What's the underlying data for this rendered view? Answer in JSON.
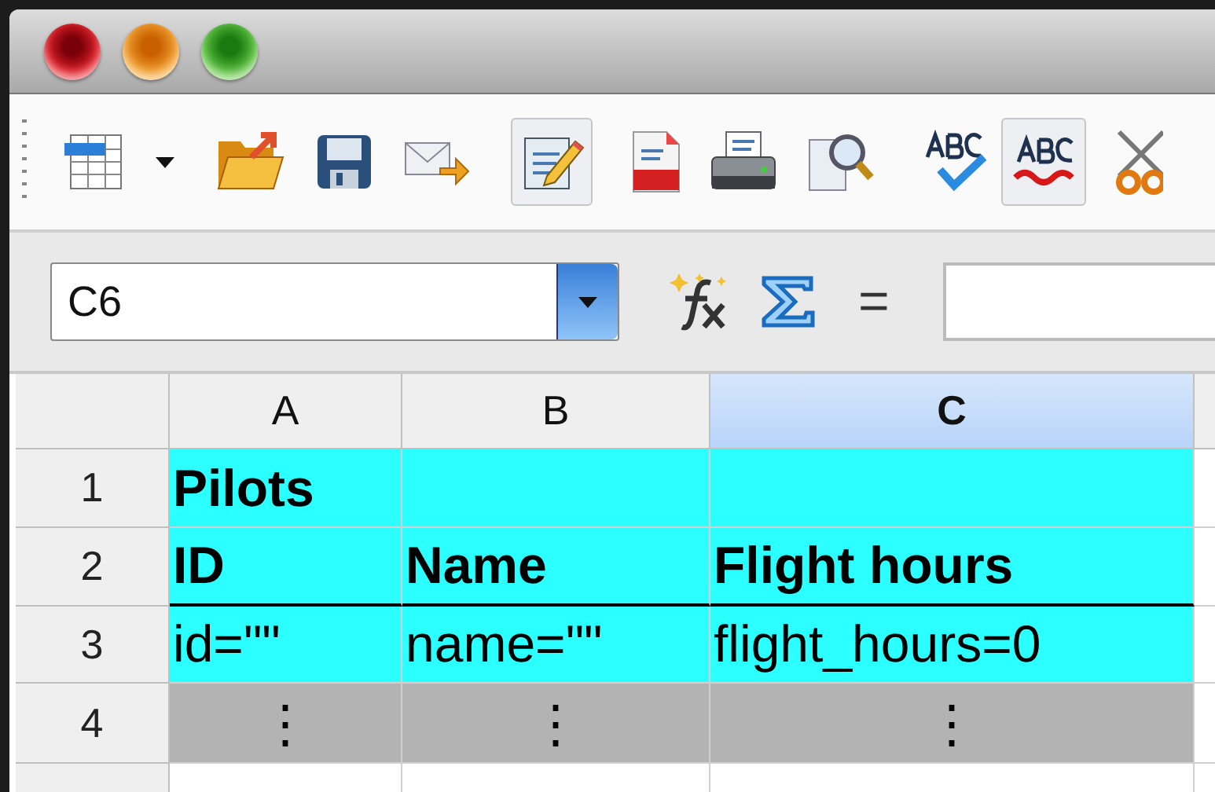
{
  "window": {
    "buttons": [
      {
        "kind": "close"
      },
      {
        "kind": "minimize"
      },
      {
        "kind": "zoom"
      }
    ]
  },
  "toolbar": [
    {
      "kind": "table",
      "pressed": false
    },
    {
      "kind": "caret",
      "pressed": false
    },
    {
      "kind": "folder",
      "pressed": false
    },
    {
      "kind": "save",
      "pressed": false
    },
    {
      "kind": "mail",
      "pressed": false
    },
    {
      "kind": "edit",
      "pressed": true
    },
    {
      "kind": "pdf",
      "pressed": false
    },
    {
      "kind": "print",
      "pressed": false
    },
    {
      "kind": "preview",
      "pressed": false
    },
    {
      "kind": "spellcheck",
      "pressed": false
    },
    {
      "kind": "autospell",
      "pressed": true
    },
    {
      "kind": "cut",
      "pressed": false
    }
  ],
  "formula_bar": {
    "name_box": "C6",
    "equals": "="
  },
  "sheet": {
    "columns": [
      {
        "label": "A",
        "selected": false
      },
      {
        "label": "B",
        "selected": false
      },
      {
        "label": "C",
        "selected": true
      }
    ],
    "rows": [
      {
        "number": "1",
        "color": "#2bffff",
        "cells": [
          {
            "text": "Pilots",
            "bold": true
          },
          {},
          {}
        ]
      },
      {
        "number": "2",
        "color": "#2bffff",
        "underline": true,
        "cells": [
          {
            "text": "ID",
            "bold": true
          },
          {
            "text": "Name",
            "bold": true
          },
          {
            "text": "Flight hours",
            "bold": true
          }
        ]
      },
      {
        "number": "3",
        "color": "#2bffff",
        "cells": [
          {
            "text": "id=\"\"",
            "bold": false
          },
          {
            "text": "name=\"\"",
            "bold": false
          },
          {
            "text": "flight_hours=0",
            "bold": false
          }
        ]
      },
      {
        "number": "4",
        "color": "#b3b3b3",
        "cells": [
          {
            "text": "⋮",
            "bold": false,
            "center": true
          },
          {
            "text": "⋮",
            "bold": false,
            "center": true
          },
          {
            "text": "⋮",
            "bold": false,
            "center": true
          }
        ]
      }
    ]
  }
}
